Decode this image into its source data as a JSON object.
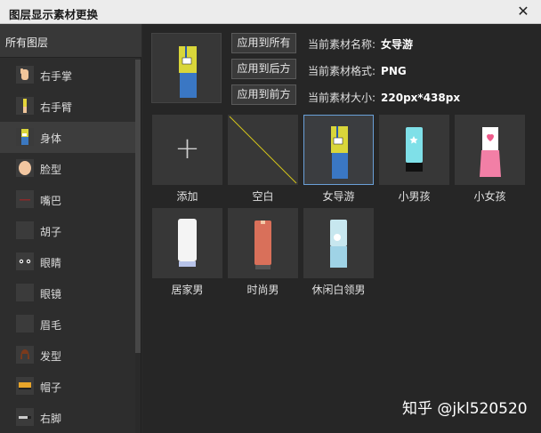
{
  "window": {
    "title": "图层显示素材更换",
    "close_glyph": "✕"
  },
  "sidebar": {
    "header": "所有图层",
    "items": [
      {
        "label": "右手掌",
        "icon": "hand-icon"
      },
      {
        "label": "右手臂",
        "icon": "arm-icon"
      },
      {
        "label": "身体",
        "icon": "body-icon",
        "selected": true
      },
      {
        "label": "脸型",
        "icon": "face-icon"
      },
      {
        "label": "嘴巴",
        "icon": "mouth-icon"
      },
      {
        "label": "胡子",
        "icon": "beard-icon"
      },
      {
        "label": "眼睛",
        "icon": "eyes-icon"
      },
      {
        "label": "眼镜",
        "icon": "glasses-icon"
      },
      {
        "label": "眉毛",
        "icon": "eyebrow-icon"
      },
      {
        "label": "发型",
        "icon": "hair-icon"
      },
      {
        "label": "帽子",
        "icon": "hat-icon"
      },
      {
        "label": "右脚",
        "icon": "foot-icon"
      }
    ]
  },
  "toolbar": {
    "apply_all": "应用到所有",
    "apply_after": "应用到后方",
    "apply_before": "应用到前方"
  },
  "info": {
    "name_label": "当前素材名称:",
    "name_value": "女导游",
    "format_label": "当前素材格式:",
    "format_value": "PNG",
    "size_label": "当前素材大小:",
    "size_value": "220px*438px"
  },
  "assets": [
    {
      "label": "添加",
      "kind": "add"
    },
    {
      "label": "空白",
      "kind": "blank"
    },
    {
      "label": "女导游",
      "kind": "tour-guide",
      "selected": true
    },
    {
      "label": "小男孩",
      "kind": "boy"
    },
    {
      "label": "小女孩",
      "kind": "girl"
    },
    {
      "label": "居家男",
      "kind": "home-man"
    },
    {
      "label": "时尚男",
      "kind": "fashion-man"
    },
    {
      "label": "休闲白领男",
      "kind": "casual-man"
    }
  ],
  "watermark": "知乎 @jkl520520",
  "colors": {
    "accent": "#6aa0d8",
    "blank_line": "#d4c51a"
  }
}
